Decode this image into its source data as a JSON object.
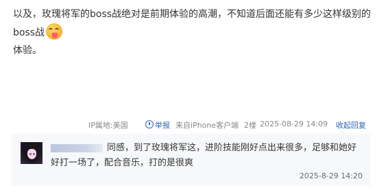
{
  "post": {
    "text_line1": "以及，玫瑰将军的boss战绝对是前期体验的高潮，不知道后面还能有多少这样级别的boss战",
    "text_line2": "体验。",
    "emoji": "tongue-out-emoji"
  },
  "meta": {
    "ip": "IP属地:美国",
    "report": "举报",
    "source": "来自iPhone客户端",
    "floor": "2楼",
    "time": "2025-08-29 14:09",
    "toggle": "收起回复"
  },
  "reply": {
    "username": "",
    "text": "同感，到了玫瑰将军这，进阶技能刚好点出来很多，足够和她好好打一场了，配合音乐，打的是很爽",
    "time": "2025-8-29 14:20"
  },
  "colors": {
    "link": "#2d64b3",
    "meta_text": "#888888",
    "reply_bg": "#f7f8fa"
  }
}
